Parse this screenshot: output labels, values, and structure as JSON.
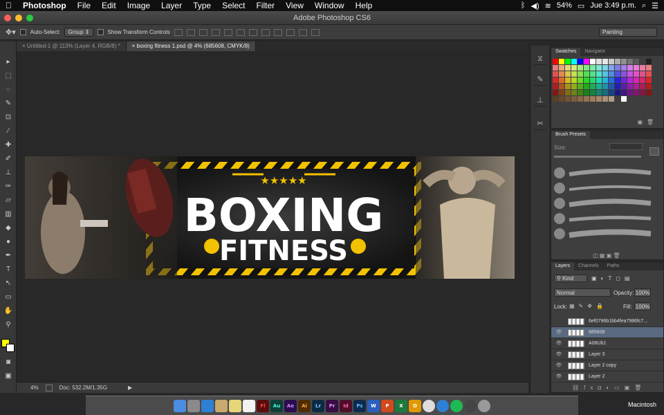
{
  "menubar": {
    "apple": "",
    "app": "Photoshop",
    "items": [
      "File",
      "Edit",
      "Image",
      "Layer",
      "Type",
      "Select",
      "Filter",
      "View",
      "Window",
      "Help"
    ],
    "battery": "54%",
    "clock": "Jue 3:49 p.m."
  },
  "window": {
    "title": "Adobe Photoshop CS6"
  },
  "options": {
    "auto_select": "Auto-Select:",
    "group": "Group",
    "transform": "Show Transform Controls",
    "workspace": "Painting"
  },
  "tabs": [
    {
      "label": "Untitled-1 @ 113% (Layer 4, RGB/8) *"
    },
    {
      "label": "boxing fitness 1.psd @ 4% (685608, CMYK/8)"
    }
  ],
  "document": {
    "line1": "BOXING",
    "line2": "FITNESS",
    "stars": "★★★★★"
  },
  "status": {
    "zoom": "4%",
    "doc": "Doc: 532.2M/1.35G"
  },
  "swatches": {
    "tabs": [
      "Swatches",
      "Navigator"
    ]
  },
  "brushes": {
    "title": "Brush Presets",
    "size_label": "Size:"
  },
  "layers": {
    "tabs": [
      "Layers",
      "Channels",
      "Paths"
    ],
    "kind": "Kind",
    "blend": "Normal",
    "opacity_label": "Opacity:",
    "opacity": "100%",
    "lock_label": "Lock:",
    "fill_label": "Fill:",
    "fill": "100%",
    "items": [
      {
        "name": "6ef0796b1bb4fea7986fc7...",
        "visible": false
      },
      {
        "name": "685608",
        "visible": true
      },
      {
        "name": "A08Ub1",
        "visible": true
      },
      {
        "name": "Layer 3",
        "visible": true
      },
      {
        "name": "Layer 2 copy",
        "visible": true
      },
      {
        "name": "Layer 2",
        "visible": true
      }
    ]
  },
  "dock": {
    "label": "Macintosh",
    "apps": [
      "Fl",
      "Au",
      "Ae",
      "Ai",
      "Lr",
      "Pr",
      "Id",
      "Ps",
      "W",
      "P",
      "X",
      "O"
    ]
  },
  "colors": {
    "foreground": "#ffff00",
    "background": "#ffffff",
    "accent": "#f2c200"
  }
}
